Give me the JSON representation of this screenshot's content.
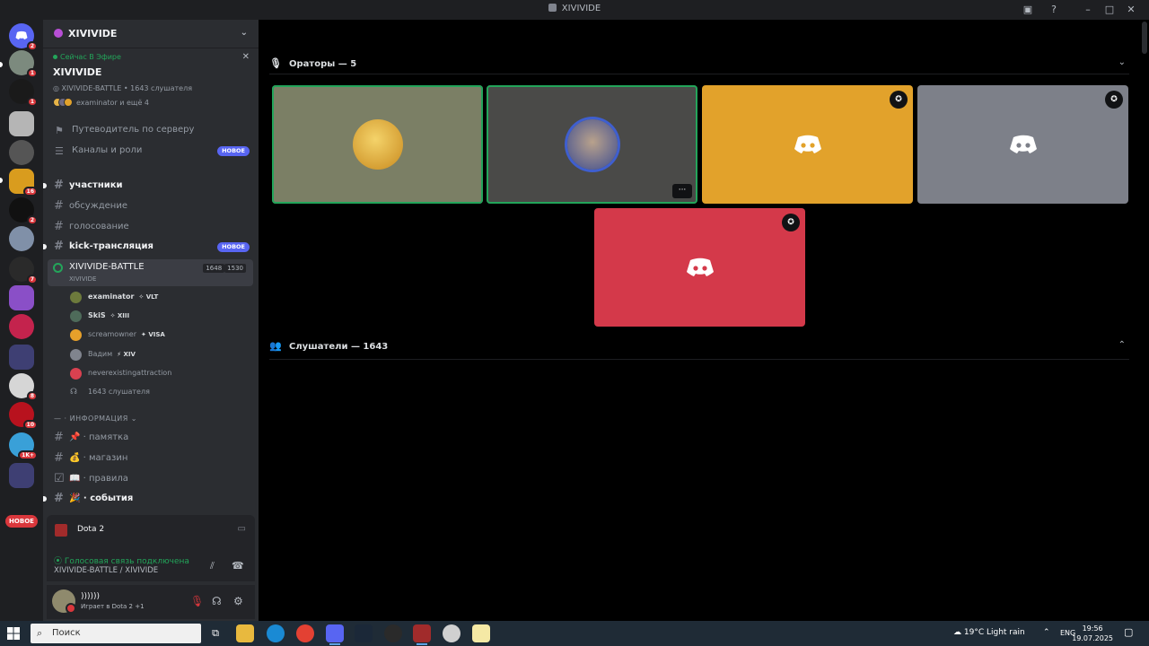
{
  "window": {
    "title": "XIVIVIDE"
  },
  "rail": {
    "badges": [
      "2",
      "1",
      "1",
      "16",
      "2",
      "7",
      "8",
      "10",
      "1K+",
      "2"
    ],
    "new_label": "НОВОЕ"
  },
  "guild": {
    "name": "XIVIVIDE"
  },
  "live": {
    "label": "Сейчас В Эфире",
    "title": "XIVIVIDE",
    "subtitle": "XIVIVIDE-BATTLE • 1643 слушателя",
    "participants": "examinator и ещё 4"
  },
  "nav": {
    "guide": "Путеводитель по серверу",
    "channels_roles": "Каналы и роли",
    "new_tag": "НОВОЕ"
  },
  "channels": [
    {
      "name": "участники"
    },
    {
      "name": "обсуждение"
    },
    {
      "name": "голосование"
    },
    {
      "name": "kick-трансляция"
    }
  ],
  "voice_channel": {
    "name": "XIVIVIDE-BATTLE",
    "subtitle": "XIVIVIDE",
    "count_a": "1648",
    "count_b": "1530"
  },
  "voice_users": [
    {
      "name": "examinator",
      "tag": "✧ VLT",
      "color": "#6d7a3c"
    },
    {
      "name": "SkiS",
      "tag": "✧ XIII",
      "color": "#4e6b5a"
    },
    {
      "name": "screamowner",
      "tag": "✦ VISA",
      "color": "#e7a02a"
    },
    {
      "name": "Вадим",
      "tag": "⚡ XIV",
      "color": "#80848e"
    },
    {
      "name": "neverexistingattraction",
      "tag": "",
      "color": "#da4150"
    }
  ],
  "listeners_line": "1643 слушателя",
  "category": "— · ИНФОРМАЦИЯ ⌄",
  "info_channels": [
    {
      "emoji": "📌",
      "name": "памятка"
    },
    {
      "emoji": "💰",
      "name": "магазин"
    },
    {
      "emoji": "📖",
      "name": "правила"
    },
    {
      "emoji": "🎉",
      "name": "события"
    }
  ],
  "game_activity": {
    "name": "Dota 2"
  },
  "voice_status": {
    "line1": "Голосовая связь подключена",
    "line2": "XIVIVIDE-BATTLE / XIVIVIDE"
  },
  "user": {
    "name": "))))))",
    "activity": "Играет в Dota 2 +1"
  },
  "stage": {
    "speakers_header": "Ораторы — 5",
    "listeners_header": "Слушатели — 1643",
    "tiles": [
      {
        "bg": "#7b7f65",
        "speaking": true,
        "kind": "avatar",
        "avatar_color": "#e6b347"
      },
      {
        "bg": "#4a4a48",
        "speaking": true,
        "kind": "avatar",
        "avatar_color": "#6f6a82",
        "more": "···"
      },
      {
        "bg": "#e2a22b",
        "speaking": false,
        "kind": "logo",
        "mod": "✪"
      },
      {
        "bg": "#7d8089",
        "speaking": false,
        "kind": "logo",
        "mod": "✪"
      },
      {
        "bg": "#d4394a",
        "speaking": false,
        "kind": "logo",
        "mod": "✪"
      }
    ]
  },
  "taskbar": {
    "search_placeholder": "Поиск",
    "weather": "19°C  Light rain",
    "lang": "ENG",
    "time": "19:56",
    "date": "19.07.2025"
  },
  "colors": {
    "online": "#23a55a",
    "danger": "#da373c",
    "blurple": "#5865f2"
  }
}
